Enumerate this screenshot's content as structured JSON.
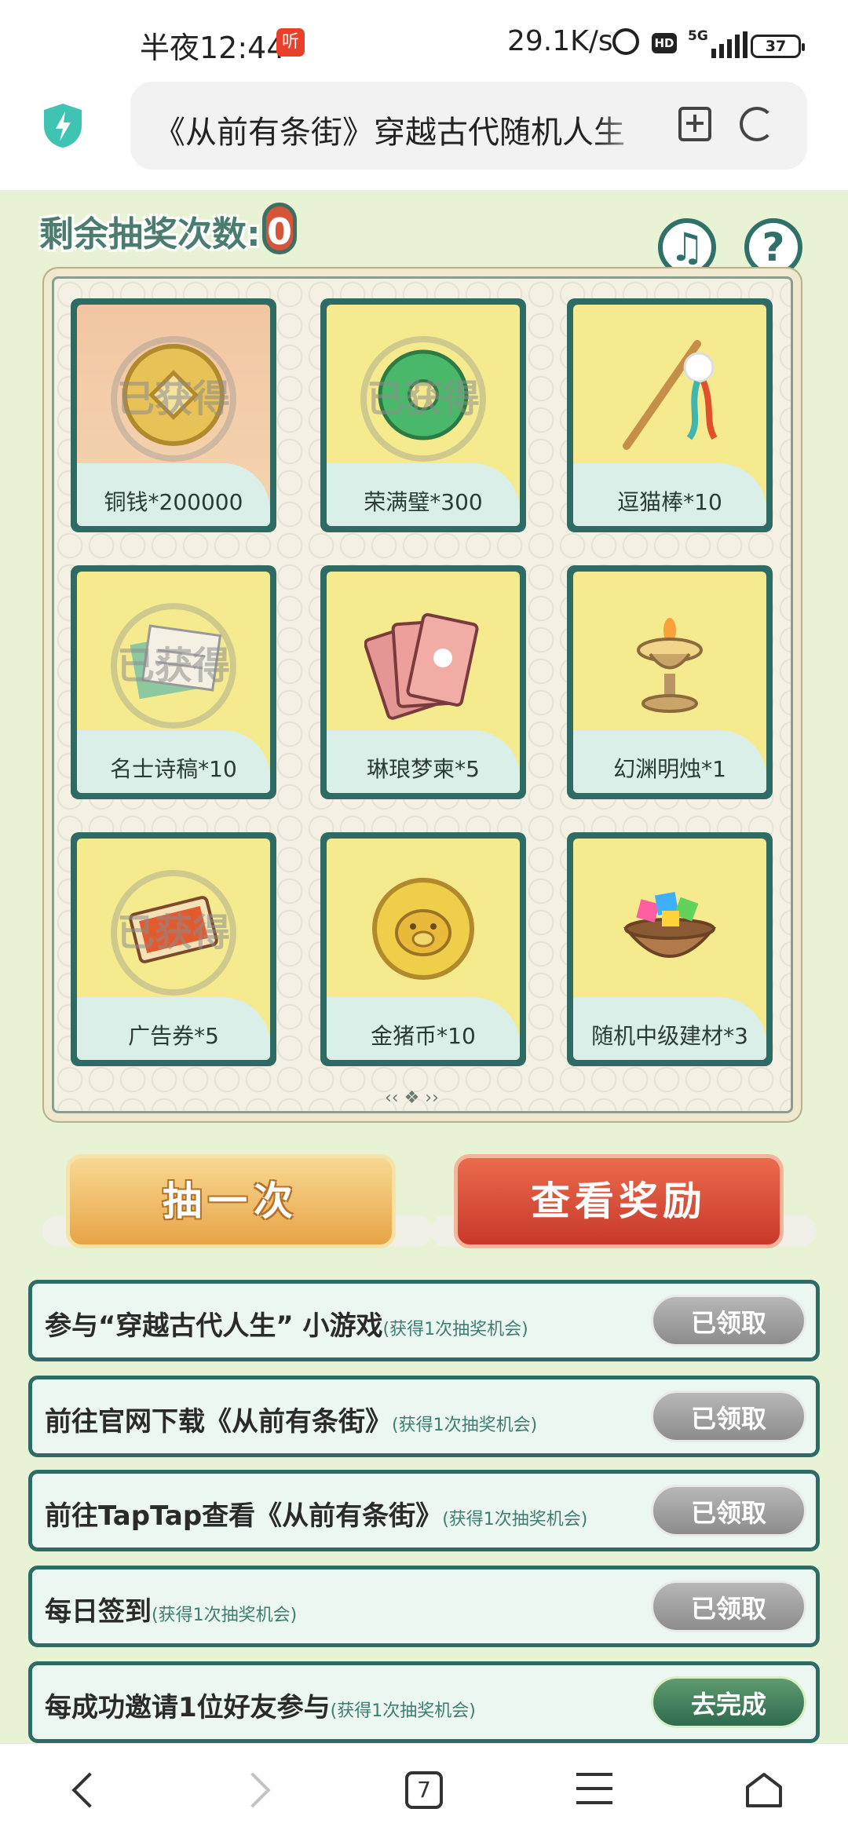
{
  "status_bar": {
    "time": "半夜12:44",
    "badge": "听",
    "network_speed": "29.1K/s",
    "hd": "HD",
    "network_type": "5G",
    "battery": "37"
  },
  "browser": {
    "url_title": "《从前有条街》穿越古代随机人生"
  },
  "game": {
    "remaining_label": "剩余抽奖次数:",
    "remaining_count": "0",
    "music_icon": "♫",
    "help_icon": "?",
    "claimed_stamp": "已获得",
    "prizes": [
      {
        "label": "铜钱*200000",
        "claimed": true,
        "icon": "coin-icon"
      },
      {
        "label": "荣满璧*300",
        "claimed": true,
        "icon": "jade-disc-icon"
      },
      {
        "label": "逗猫棒*10",
        "claimed": false,
        "icon": "cat-teaser-icon"
      },
      {
        "label": "名士诗稿*10",
        "claimed": true,
        "icon": "poem-scroll-icon"
      },
      {
        "label": "琳琅梦柬*5",
        "claimed": false,
        "icon": "letter-cards-icon"
      },
      {
        "label": "幻渊明烛*1",
        "claimed": false,
        "icon": "oil-lamp-icon"
      },
      {
        "label": "广告券*5",
        "claimed": true,
        "icon": "ad-ticket-icon"
      },
      {
        "label": "金猪币*10",
        "claimed": false,
        "icon": "pig-coin-icon"
      },
      {
        "label": "随机中级建材*3",
        "claimed": false,
        "icon": "gem-pot-icon"
      }
    ],
    "draw_button": "抽一次",
    "rewards_button": "查看奖励",
    "tasks": [
      {
        "text": "参与“穿越古代人生” 小游戏",
        "note": "(获得1次抽奖机会)",
        "button": "已领取",
        "state": "claimed"
      },
      {
        "text": "前往官网下载《从前有条街》",
        "note": "(获得1次抽奖机会)",
        "button": "已领取",
        "state": "claimed"
      },
      {
        "text": "前往TapTap查看《从前有条街》",
        "note": "(获得1次抽奖机会)",
        "button": "已领取",
        "state": "claimed"
      },
      {
        "text": "每日签到",
        "note": "(获得1次抽奖机会)",
        "button": "已领取",
        "state": "claimed"
      },
      {
        "text": "每成功邀请1位好友参与",
        "note": "(获得1次抽奖机会)",
        "button": "去完成",
        "state": "todo"
      }
    ]
  },
  "nav": {
    "tab_count": "7"
  },
  "colors": {
    "page_bg": "#e7f3d4",
    "frame_teal": "#2e6b65",
    "prize_yellow": "#f5ea8e",
    "draw_orange": "#e8a447",
    "rewards_red": "#c9382a",
    "claimed_gray": "#8c8c8c",
    "todo_green": "#2d6b4e"
  }
}
